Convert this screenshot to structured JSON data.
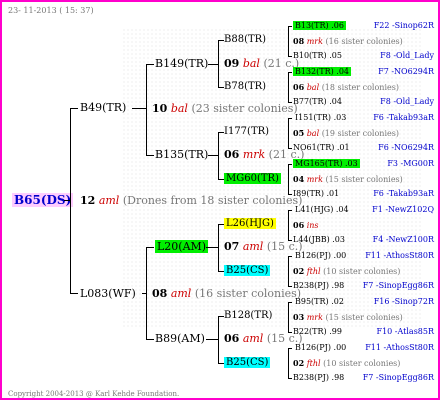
{
  "header_date": "23- 11-2013 ( 15: 37)",
  "footer": "Copyright 2004-2013 @ Karl Kehde Foundation.",
  "root": {
    "label": "B65(DS)",
    "num": "12",
    "sym": "aml",
    "note": "(Drones from 18 sister colonies)"
  },
  "n1": {
    "label": "B49(TR)",
    "num": "10",
    "sym": "bal",
    "note": "(23 sister colonies)"
  },
  "n2": {
    "label": "L083(WF)",
    "num": "08",
    "sym": "aml",
    "note": "(16 sister colonies)"
  },
  "n11": {
    "label": "B149(TR)",
    "num": "09",
    "sym": "bal",
    "note": "(21 c.)"
  },
  "n12": {
    "label": "B135(TR)",
    "num": "06",
    "sym": "mrk",
    "note": "(21 c.)"
  },
  "n21": {
    "label": "L20(AM)",
    "num": "07",
    "sym": "aml",
    "note": "(15 c.)"
  },
  "n22": {
    "label": "B89(AM)",
    "num": "06",
    "sym": "aml",
    "note": "(15 c.)"
  },
  "g111": "B88(TR)",
  "g112": "B78(TR)",
  "g121": "I177(TR)",
  "g122": "MG60(TR)",
  "g211": "L26(HJG)",
  "g212": "B25(CS)",
  "g221": "B128(TR)",
  "g222": "B25(CS)",
  "leaves": [
    {
      "top": "B13(TR) .06",
      "mid_num": "08",
      "mid_sym": "mrk",
      "mid_note": "(16 sister colonies)",
      "bot": "B10(TR) .05",
      "r1": "F22 -Sinop62R",
      "r2": "F8 -Old_Lady"
    },
    {
      "top": "B132(TR) .04",
      "mid_num": "06",
      "mid_sym": "bal",
      "mid_note": "(18 sister colonies)",
      "bot": "B77(TR) .04",
      "r1": "F7 -NO6294R",
      "r2": "F8 -Old_Lady"
    },
    {
      "top": "I151(TR) .03",
      "mid_num": "05",
      "mid_sym": "bal",
      "mid_note": "(19 sister colonies)",
      "bot": "NO61(TR) .01",
      "r1": "F6 -Takab93aR",
      "r2": "F6 -NO6294R"
    },
    {
      "top": "MG165(TR) .03",
      "mid_num": "04",
      "mid_sym": "mrk",
      "mid_note": "(15 sister colonies)",
      "bot": "I89(TR) .01",
      "r1": "F3 -MG00R",
      "r2": "F6 -Takab93aR"
    },
    {
      "top": "L41(HJG) .04",
      "mid_num": "06",
      "mid_sym": "ins",
      "mid_note": "",
      "bot": "L44(JBB) .03",
      "r1": "F1 -NewZ102Q",
      "r2": "F4 -NewZ100R"
    },
    {
      "top": "B126(PJ) .00",
      "mid_num": "02",
      "mid_sym": "fthl",
      "mid_note": "(10 sister colonies)",
      "bot": "B238(PJ) .98",
      "r1": "F11 -AthosSt80R",
      "r2": "F7 -SinopEgg86R"
    },
    {
      "top": "B95(TR) .02",
      "mid_num": "03",
      "mid_sym": "mrk",
      "mid_note": "(15 sister colonies)",
      "bot": "B22(TR) .99",
      "r1": "F16 -Sinop72R",
      "r2": "F10 -Atlas85R"
    },
    {
      "top": "B126(PJ) .00",
      "mid_num": "02",
      "mid_sym": "fthl",
      "mid_note": "(10 sister colonies)",
      "bot": "B238(PJ) .98",
      "r1": "F11 -AthosSt80R",
      "r2": "F7 -SinopEgg86R"
    }
  ]
}
